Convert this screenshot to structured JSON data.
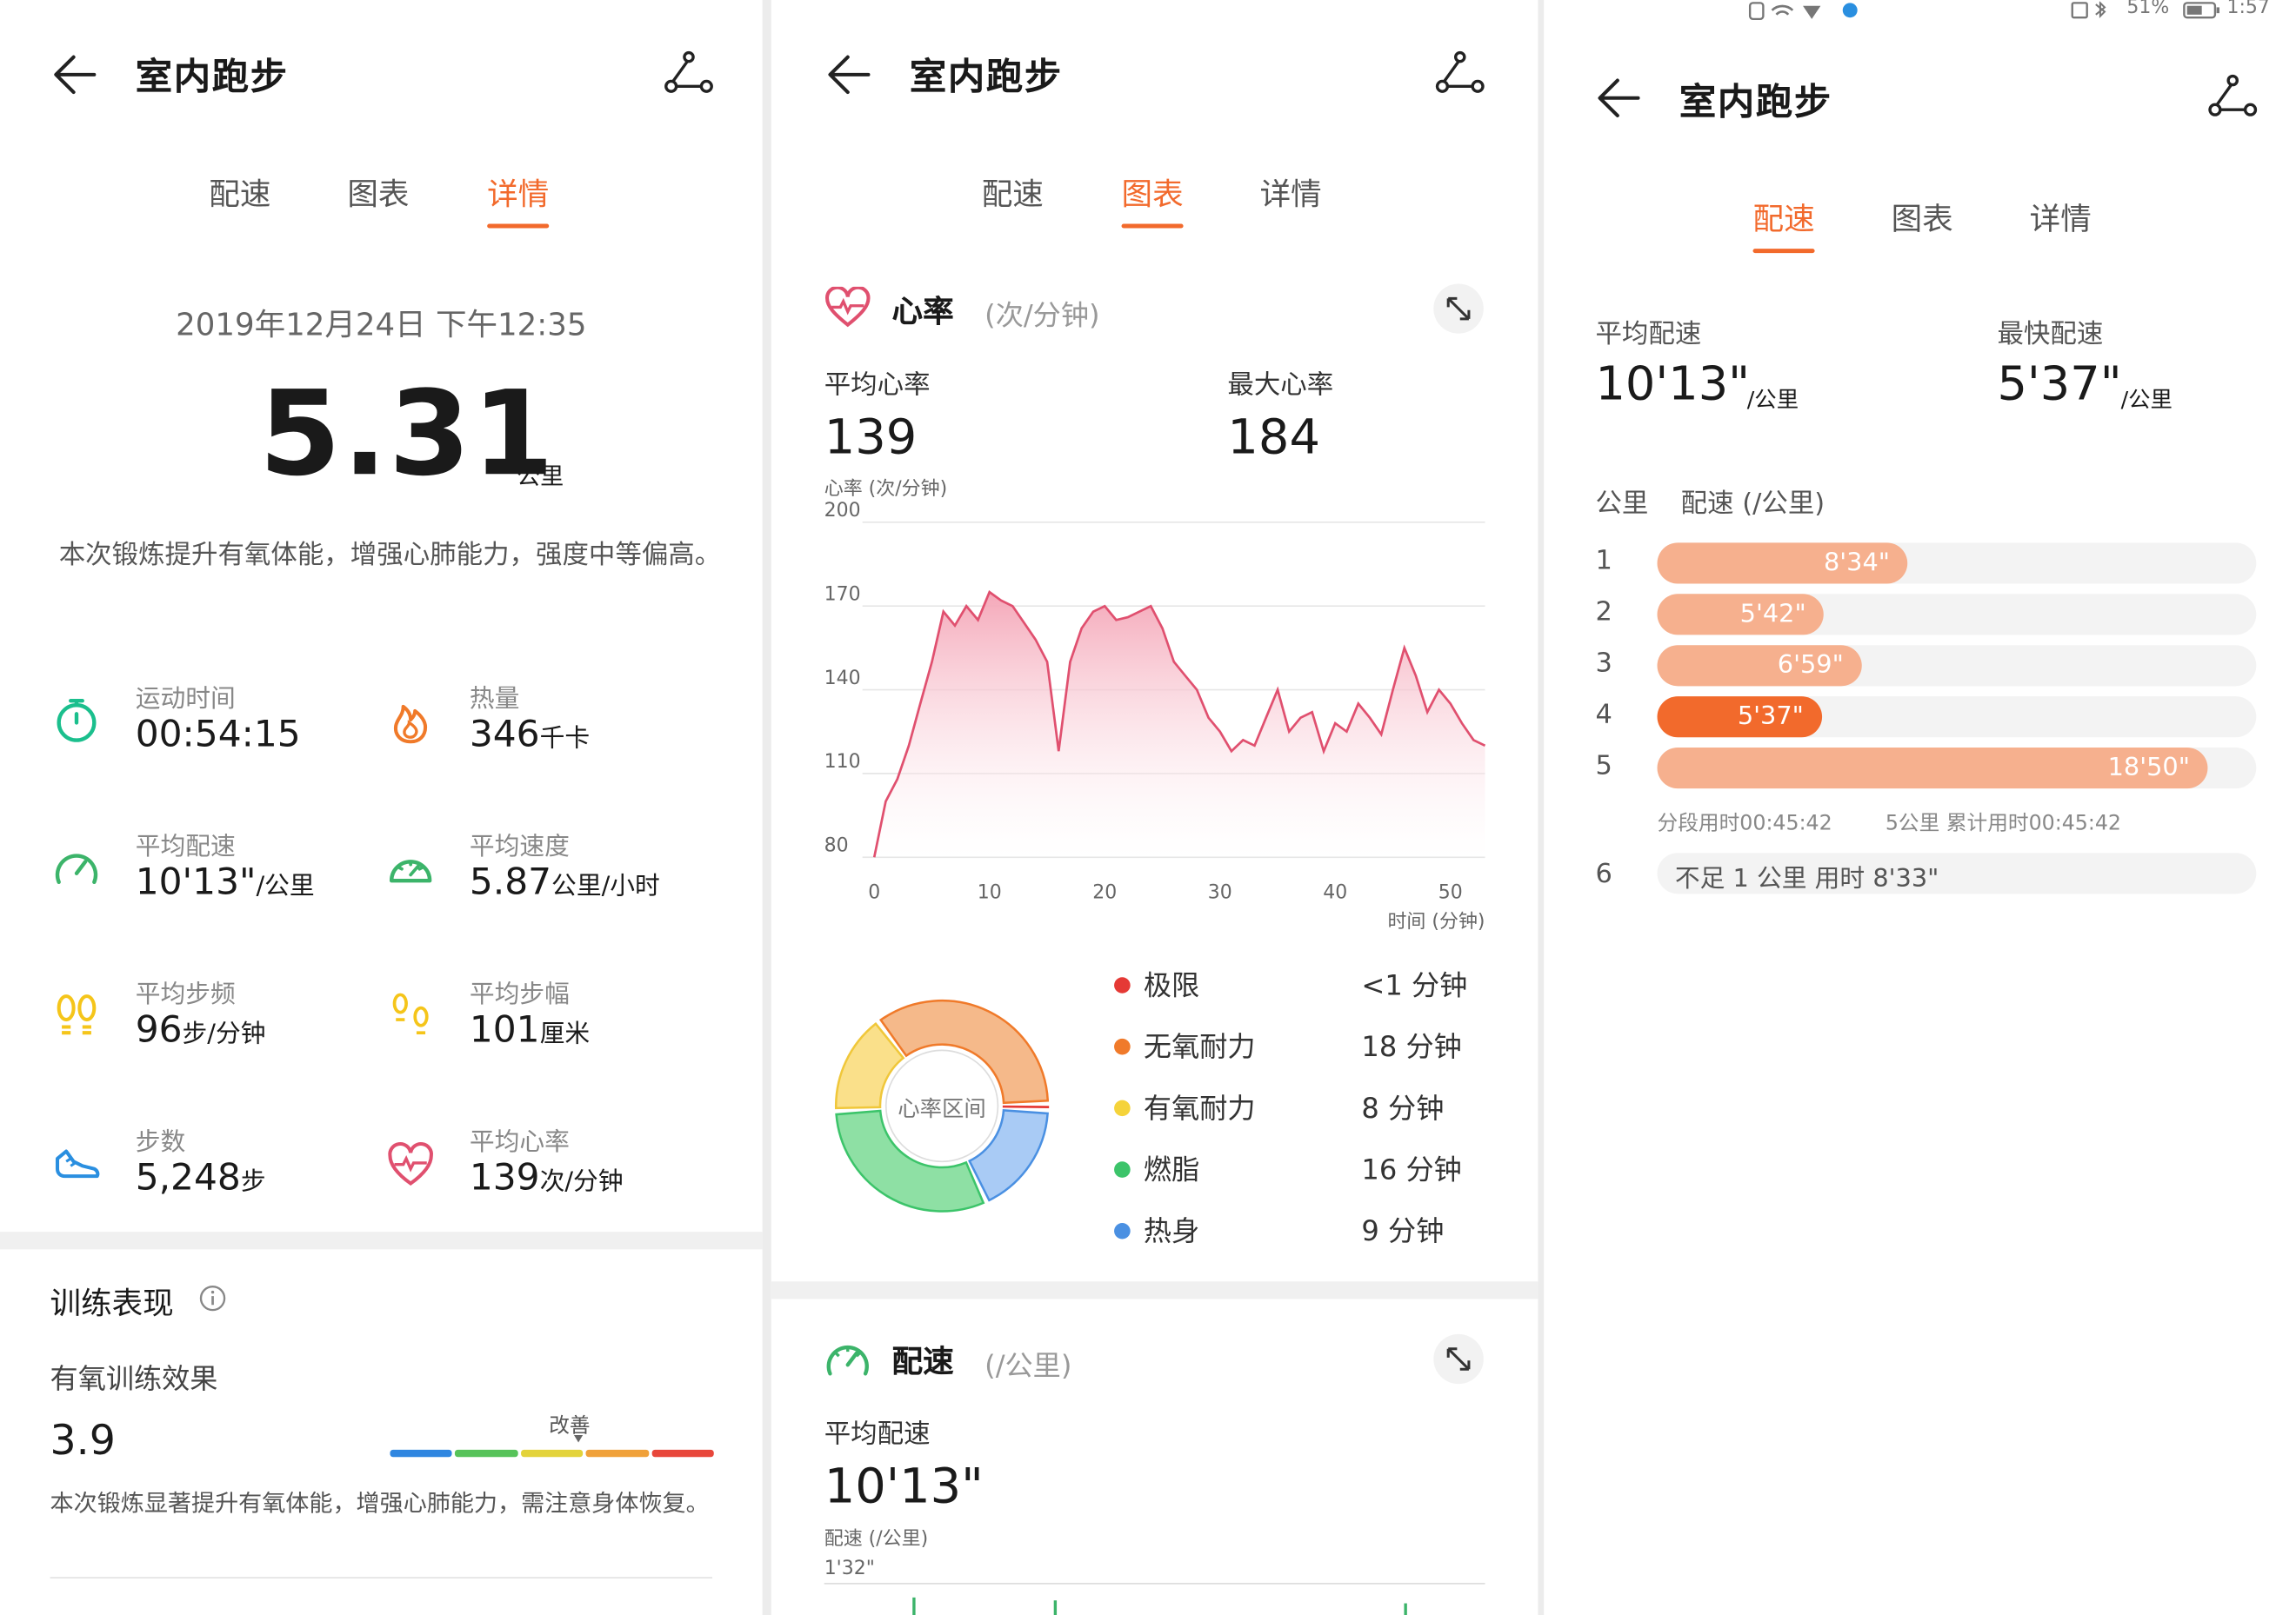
{
  "page_title": "室内跑步",
  "tabs": [
    "配速",
    "图表",
    "详情"
  ],
  "colors": {
    "accent": "#f26a2c",
    "hr_fill": "#f4a3b5",
    "hr_line": "#e0506f"
  },
  "status_bar": {
    "battery": "51%",
    "time": "1:57"
  },
  "summary": {
    "datetime": "2019年12月24日 下午12:35",
    "distance": "5.31",
    "distance_unit": "公里",
    "description": "本次锻炼提升有氧体能，增强心肺能力，强度中等偏高。",
    "stats": [
      {
        "label": "运动时间",
        "value": "00:54:15",
        "unit": "",
        "icon": "stopwatch-icon"
      },
      {
        "label": "热量",
        "value": "346",
        "unit": "千卡",
        "icon": "flame-icon"
      },
      {
        "label": "平均配速",
        "value": "10'13\"",
        "unit": "/公里",
        "icon": "speedometer-icon"
      },
      {
        "label": "平均速度",
        "value": "5.87",
        "unit": "公里/小时",
        "icon": "gauge-icon"
      },
      {
        "label": "平均步频",
        "value": "96",
        "unit": "步/分钟",
        "icon": "footprints-icon"
      },
      {
        "label": "平均步幅",
        "value": "101",
        "unit": "厘米",
        "icon": "stride-icon"
      },
      {
        "label": "步数",
        "value": "5,248",
        "unit": "步",
        "icon": "shoe-icon"
      },
      {
        "label": "平均心率",
        "value": "139",
        "unit": "次/分钟",
        "icon": "heart-rate-icon"
      }
    ]
  },
  "training": {
    "title": "训练表现",
    "aerobic_label": "有氧训练效果",
    "aerobic_value": "3.9",
    "scale_marker_label": "改善",
    "scale_marker_position": 0.58,
    "scale_colors": [
      "#2f86e0",
      "#57c35a",
      "#e3d33b",
      "#f0a13a",
      "#e8473b"
    ],
    "note": "本次锻炼显著提升有氧体能，增强心肺能力，需注意身体恢复。"
  },
  "heart_rate": {
    "title": "心率",
    "unit": "(次/分钟)",
    "avg_label": "平均心率",
    "avg_value": "139",
    "max_label": "最大心率",
    "max_value": "184",
    "chart_unit": "心率 (次/分钟)",
    "x_axis_label": "时间 (分钟)",
    "zones_center": "心率区间",
    "zones": [
      {
        "name": "极限",
        "value": "<1 分钟",
        "color": "#e53935",
        "minutes": 0.5
      },
      {
        "name": "无氧耐力",
        "value": "18 分钟",
        "color": "#f07a2a",
        "minutes": 18
      },
      {
        "name": "有氧耐力",
        "value": "8 分钟",
        "color": "#f5d33a",
        "minutes": 8
      },
      {
        "name": "燃脂",
        "value": "16 分钟",
        "color": "#3cc46a",
        "minutes": 16
      },
      {
        "name": "热身",
        "value": "9 分钟",
        "color": "#4a90e2",
        "minutes": 9
      }
    ]
  },
  "pace_card": {
    "title": "配速",
    "unit": "(/公里)",
    "avg_label": "平均配速",
    "avg_value": "10'13\"",
    "chart_unit": "配速 (/公里)",
    "first_tick": "1'32\""
  },
  "pace_detail": {
    "avg_label": "平均配速",
    "avg_value": "10'13\"",
    "fast_label": "最快配速",
    "fast_value": "5'37\"",
    "unit": "/公里",
    "col_km": "公里",
    "col_pace": "配速 (/公里)",
    "rows": [
      {
        "km": "1",
        "pace": "8'34\"",
        "seconds": 514,
        "fastest": false
      },
      {
        "km": "2",
        "pace": "5'42\"",
        "seconds": 342,
        "fastest": false
      },
      {
        "km": "3",
        "pace": "6'59\"",
        "seconds": 419,
        "fastest": false
      },
      {
        "km": "4",
        "pace": "5'37\"",
        "seconds": 337,
        "fastest": true
      },
      {
        "km": "5",
        "pace": "18'50\"",
        "seconds": 1130,
        "fastest": false
      }
    ],
    "split_time": "分段用时00:45:42",
    "cumulative": "5公里 累计用时00:45:42",
    "last_km": "6",
    "last_note": "不足 1 公里 用时 8'33\""
  },
  "chart_data": {
    "type": "area",
    "title": "",
    "xlabel": "时间 (分钟)",
    "ylabel": "心率 (次/分钟)",
    "xlim": [
      0,
      53
    ],
    "ylim": [
      80,
      200
    ],
    "x_ticks": [
      0,
      10,
      20,
      30,
      40,
      50
    ],
    "y_ticks": [
      80,
      110,
      140,
      170,
      200
    ],
    "x": [
      0,
      1,
      2,
      3,
      4,
      5,
      6,
      7,
      8,
      9,
      10,
      11,
      12,
      13,
      14,
      15,
      16,
      17,
      18,
      19,
      20,
      21,
      22,
      23,
      24,
      25,
      26,
      27,
      28,
      29,
      30,
      31,
      32,
      33,
      34,
      35,
      36,
      37,
      38,
      39,
      40,
      41,
      42,
      43,
      44,
      45,
      46,
      47,
      48,
      49,
      50,
      51,
      52,
      53
    ],
    "series": [
      {
        "values": [
          80,
          100,
          108,
          120,
          135,
          150,
          168,
          163,
          170,
          165,
          175,
          172,
          170,
          164,
          158,
          150,
          118,
          150,
          162,
          168,
          170,
          165,
          166,
          168,
          170,
          162,
          150,
          145,
          140,
          130,
          125,
          118,
          122,
          120,
          130,
          140,
          125,
          130,
          132,
          118,
          128,
          125,
          135,
          130,
          124,
          140,
          155,
          145,
          132,
          140,
          135,
          128,
          122,
          120
        ]
      }
    ]
  }
}
